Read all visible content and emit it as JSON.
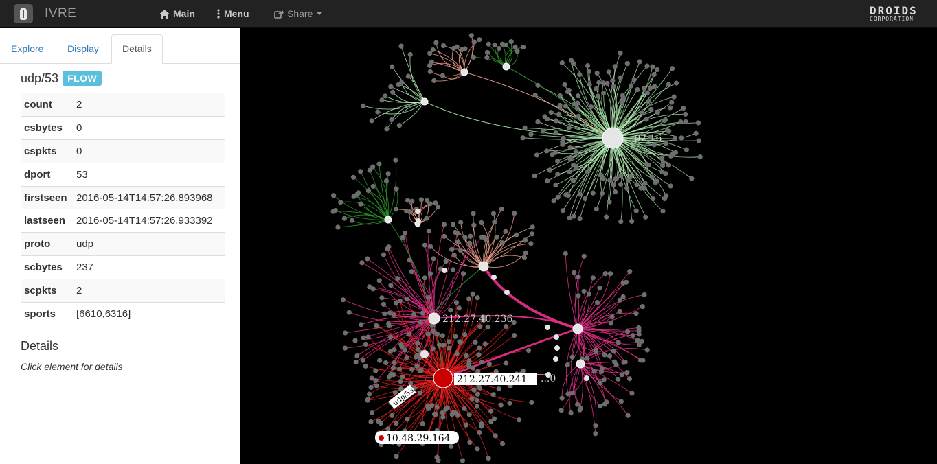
{
  "navbar": {
    "brand": "IVRE",
    "main_label": "Main",
    "menu_label": "Menu",
    "share_label": "Share",
    "partner_logo_top": "DROIDS",
    "partner_logo_bottom": "CORPORATION"
  },
  "sidebar": {
    "tabs": [
      {
        "label": "Explore",
        "active": false
      },
      {
        "label": "Display",
        "active": false
      },
      {
        "label": "Details",
        "active": true
      }
    ],
    "flow": {
      "title": "udp/53",
      "badge": "FLOW",
      "properties": [
        {
          "key": "count",
          "value": "2"
        },
        {
          "key": "csbytes",
          "value": "0"
        },
        {
          "key": "cspkts",
          "value": "0"
        },
        {
          "key": "dport",
          "value": "53"
        },
        {
          "key": "firstseen",
          "value": "2016-05-14T14:57:26.893968"
        },
        {
          "key": "lastseen",
          "value": "2016-05-14T14:57:26.933392"
        },
        {
          "key": "proto",
          "value": "udp"
        },
        {
          "key": "scbytes",
          "value": "237"
        },
        {
          "key": "scpkts",
          "value": "2"
        },
        {
          "key": "sports",
          "value": "[6610,6316]"
        }
      ]
    },
    "details": {
      "title": "Details",
      "hint": "Click element for details"
    }
  },
  "graph": {
    "hub_labels": {
      "hub_a": "...02.16",
      "hub_b": "212.27.40.236",
      "hub_c": "212.27.40.241",
      "hub_d": "10.48.29.164",
      "hub_e": "...0",
      "edge": "udp/53"
    },
    "colors": {
      "background": "#000000",
      "leaf_node": "#6e6e6e",
      "hub_node": "#e6e6e6",
      "selected_node": "#cc0000",
      "edge_green_light": "#b3ecb3",
      "edge_green": "#2e9b2e",
      "edge_salmon": "#f2a38f",
      "edge_pink": "#e8318c",
      "edge_red": "#ff2020",
      "badge": "#5bc0de",
      "link": "#337ab7"
    }
  }
}
